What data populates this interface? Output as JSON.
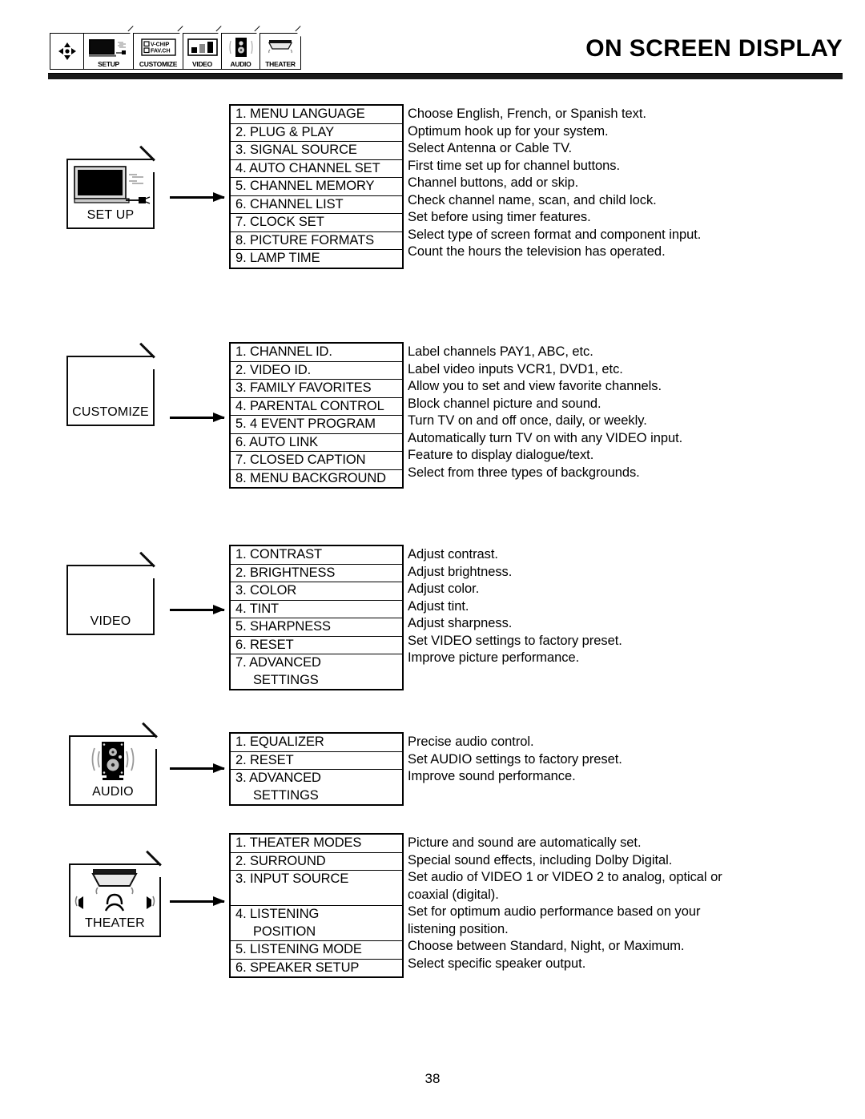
{
  "header": {
    "title": "ON SCREEN DISPLAY",
    "strip": [
      {
        "name": "dpad",
        "label": "",
        "icon": "dpad-icon"
      },
      {
        "name": "setup",
        "label": "SETUP",
        "icon": "tv-plug-icon"
      },
      {
        "name": "customize",
        "label": "CUSTOMIZE",
        "icon": "vchip-favch-icon",
        "line1": "V-CHIP",
        "line2": "FAV.CH"
      },
      {
        "name": "video",
        "label": "VIDEO",
        "icon": "bar-levels-icon"
      },
      {
        "name": "audio",
        "label": "AUDIO",
        "icon": "speaker-icon"
      },
      {
        "name": "theater",
        "label": "THEATER",
        "icon": "theater-screen-icon"
      }
    ]
  },
  "sections": [
    {
      "id": "setup",
      "tile_label": "SET UP",
      "tile_icon": "tv-with-plug-icon",
      "rows": [
        {
          "item": "1. MENU LANGUAGE",
          "desc": "Choose English, French, or Spanish text."
        },
        {
          "item": "2. PLUG & PLAY",
          "desc": "Optimum hook up for your system."
        },
        {
          "item": "3. SIGNAL SOURCE",
          "desc": "Select Antenna or Cable TV."
        },
        {
          "item": "4. AUTO CHANNEL SET",
          "desc": "First time set up for channel buttons."
        },
        {
          "item": "5. CHANNEL MEMORY",
          "desc": "Channel buttons, add or skip."
        },
        {
          "item": "6. CHANNEL LIST",
          "desc": "Check channel name, scan, and child lock."
        },
        {
          "item": "7. CLOCK SET",
          "desc": "Set before using timer features."
        },
        {
          "item": "8. PICTURE FORMATS",
          "desc": "Select  type of screen format and component input."
        },
        {
          "item": "9. LAMP TIME",
          "desc": "Count the hours the television has operated."
        }
      ]
    },
    {
      "id": "customize",
      "tile_label": "CUSTOMIZE",
      "tile_icon": "blank-icon",
      "rows": [
        {
          "item": "1. CHANNEL ID.",
          "desc": "Label channels PAY1, ABC, etc."
        },
        {
          "item": "2. VIDEO ID.",
          "desc": "Label video inputs VCR1, DVD1, etc."
        },
        {
          "item": "3. FAMILY FAVORITES",
          "desc": "Allow you to set and view favorite channels."
        },
        {
          "item": "4. PARENTAL CONTROL",
          "desc": "Block channel picture and sound."
        },
        {
          "item": "5. 4 EVENT PROGRAM",
          "desc": "Turn TV on and off once, daily, or weekly."
        },
        {
          "item": "6. AUTO LINK",
          "desc": "Automatically turn TV on with any VIDEO input."
        },
        {
          "item": "7. CLOSED CAPTION",
          "desc": "Feature to display dialogue/text."
        },
        {
          "item": "8. MENU BACKGROUND",
          "desc": "Select from three types of backgrounds."
        }
      ]
    },
    {
      "id": "video",
      "tile_label": "VIDEO",
      "tile_icon": "blank-icon",
      "rows": [
        {
          "item": "1. CONTRAST",
          "desc": "Adjust contrast."
        },
        {
          "item": "2. BRIGHTNESS",
          "desc": "Adjust brightness."
        },
        {
          "item": "3. COLOR",
          "desc": "Adjust color."
        },
        {
          "item": "4. TINT",
          "desc": "Adjust tint."
        },
        {
          "item": "5. SHARPNESS",
          "desc": "Adjust sharpness."
        },
        {
          "item": "6. RESET",
          "desc": "Set VIDEO settings to factory preset."
        },
        {
          "item": "7. ADVANCED",
          "item2": "SETTINGS",
          "desc": "Improve picture performance."
        }
      ]
    },
    {
      "id": "audio",
      "tile_label": "AUDIO",
      "tile_icon": "speaker-icon",
      "rows": [
        {
          "item": "1. EQUALIZER",
          "desc": "Precise audio control."
        },
        {
          "item": "2. RESET",
          "desc": "Set AUDIO settings to factory preset."
        },
        {
          "item": "3. ADVANCED",
          "item2": "SETTINGS",
          "desc": "Improve sound performance."
        }
      ]
    },
    {
      "id": "theater",
      "tile_label": "THEATER",
      "tile_icon": "theater-icon",
      "rows": [
        {
          "item": "1. THEATER MODES",
          "desc": "Picture and sound are automatically set."
        },
        {
          "item": "2. SURROUND",
          "desc": "Special sound effects, including Dolby Digital."
        },
        {
          "item": "3. INPUT SOURCE",
          "desc": "Set audio of VIDEO 1 or VIDEO 2 to analog, optical or",
          "desc2": "coaxial (digital)."
        },
        {
          "item": "4. LISTENING",
          "item2": "POSITION",
          "desc": "Set for optimum audio performance based on your",
          "desc2": "listening position."
        },
        {
          "item": "5. LISTENING MODE",
          "desc": "Choose between Standard, Night, or Maximum."
        },
        {
          "item": "6. SPEAKER SETUP",
          "desc": "Select specific speaker output."
        }
      ]
    }
  ],
  "footer": {
    "page_number": "38"
  }
}
